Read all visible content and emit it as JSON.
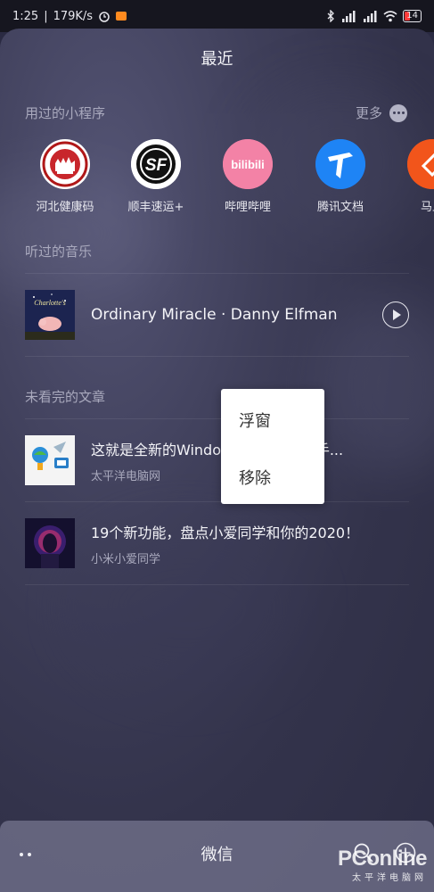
{
  "status_bar": {
    "time": "1:25",
    "speed": "179K/s",
    "battery": "14"
  },
  "sheet": {
    "title": "最近"
  },
  "mini_programs": {
    "header": "用过的小程序",
    "more_label": "更多",
    "apps": [
      {
        "label": "河北健康码",
        "icon": "hebei-health-code-icon"
      },
      {
        "label": "顺丰速运+",
        "icon": "sf-express-icon"
      },
      {
        "label": "哔哩哔哩",
        "icon": "bilibili-icon"
      },
      {
        "label": "腾讯文档",
        "icon": "tencent-docs-icon"
      },
      {
        "label": "马上",
        "icon": "orange-app-icon"
      }
    ]
  },
  "music": {
    "header": "听过的音乐",
    "track": "Ordinary Miracle  ·  Danny Elfman"
  },
  "articles": {
    "header": "未看完的文章",
    "items": [
      {
        "title": "这就是全新的Windows 10X抢先上手...",
        "source": "太平洋电脑网"
      },
      {
        "title": "19个新功能，盘点小爱同学和你的2020！",
        "source": "小米小爱同学"
      }
    ]
  },
  "context_menu": {
    "items": [
      "浮窗",
      "移除"
    ]
  },
  "bottom_bar": {
    "title": "微信"
  },
  "watermark": {
    "main": "PConline",
    "sub": "太平洋电脑网"
  },
  "colors": {
    "background": "#33334b",
    "context_menu": "#ffffff",
    "secondary_text": "#a9a9bd"
  }
}
